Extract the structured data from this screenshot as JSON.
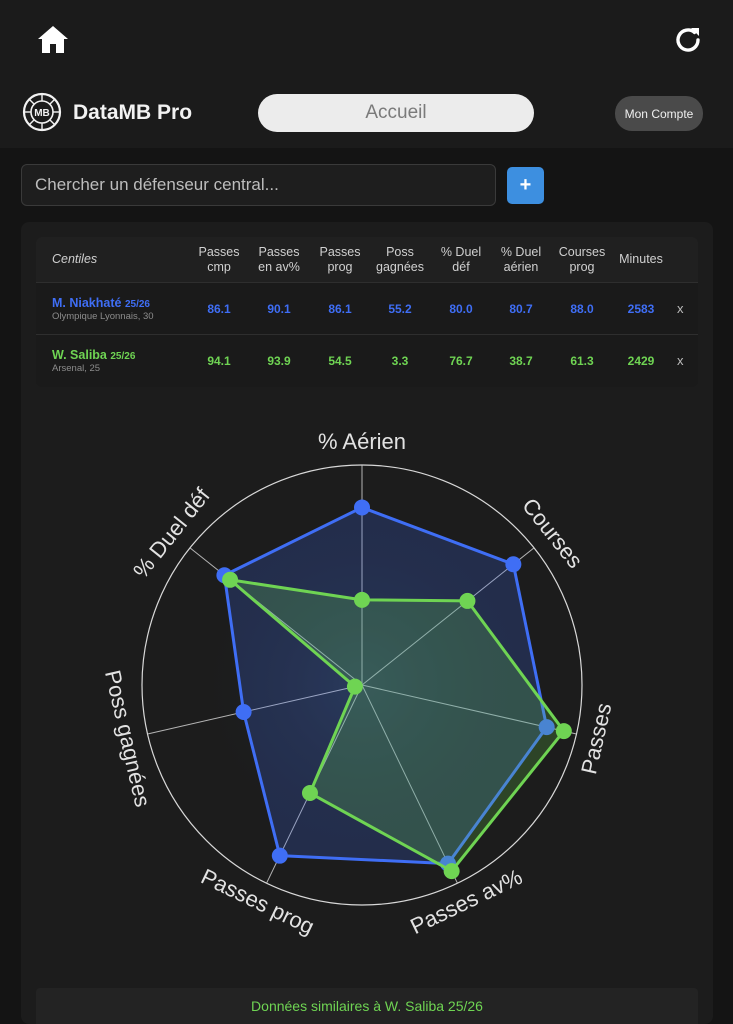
{
  "header": {
    "home_icon": "home-icon",
    "refresh_icon": "refresh-icon",
    "logo_text": "MB",
    "brand": "DataMB Pro",
    "nav_label": "Accueil",
    "account_label": "Mon Compte"
  },
  "search": {
    "placeholder": "Chercher un défenseur central...",
    "add_label": "+"
  },
  "table": {
    "first_header": "Centiles",
    "columns": [
      [
        "Passes",
        "cmp"
      ],
      [
        "Passes",
        "en av%"
      ],
      [
        "Passes",
        "prog"
      ],
      [
        "Poss",
        "gagnées"
      ],
      [
        "% Duel",
        "déf"
      ],
      [
        "% Duel",
        "aérien"
      ],
      [
        "Courses",
        "prog"
      ],
      [
        "Minutes",
        ""
      ]
    ],
    "players": [
      {
        "name": "M. Niakhaté",
        "season": "25/26",
        "club": "Olympique Lyonnais, 30",
        "values": [
          "86.1",
          "90.1",
          "86.1",
          "55.2",
          "80.0",
          "80.7",
          "88.0",
          "2583"
        ],
        "remove": "x",
        "color": "#3f6ef5"
      },
      {
        "name": "W. Saliba",
        "season": "25/26",
        "club": "Arsenal, 25",
        "values": [
          "94.1",
          "93.9",
          "54.5",
          "3.3",
          "76.7",
          "38.7",
          "61.3",
          "2429"
        ],
        "remove": "x",
        "color": "#6fd453"
      }
    ]
  },
  "chart_data": {
    "type": "radar",
    "axes": [
      "% Aérien",
      "Courses",
      "Passes",
      "Passes av%",
      "Passes prog",
      "Poss gagnées",
      "% Duel déf"
    ],
    "range": [
      0,
      100
    ],
    "series": [
      {
        "name": "M. Niakhaté",
        "values": [
          80.7,
          88.0,
          86.1,
          90.1,
          86.1,
          55.2,
          80.0
        ],
        "color": "#3f6ef5"
      },
      {
        "name": "W. Saliba",
        "values": [
          38.7,
          61.3,
          94.1,
          93.9,
          54.5,
          3.3,
          76.7
        ],
        "color": "#6fd453"
      }
    ]
  },
  "footer": {
    "similar_label": "Données similaires à W. Saliba 25/26"
  }
}
